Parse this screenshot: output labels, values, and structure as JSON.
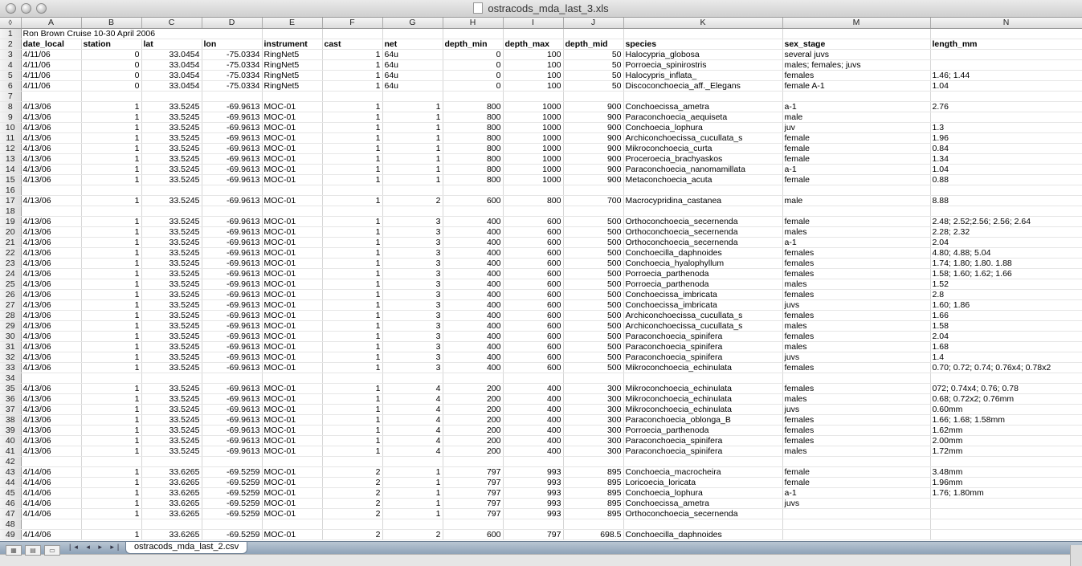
{
  "window": {
    "title": "ostracods_mda_last_3.xls"
  },
  "columns": [
    "A",
    "B",
    "C",
    "D",
    "E",
    "F",
    "G",
    "H",
    "I",
    "J",
    "K",
    "M",
    "N"
  ],
  "sheet_tab": "ostracods_mda_last_2.csv",
  "row1_text": "Ron Brown Cruise 10-30 April 2006",
  "rows": [
    {
      "n": "1",
      "c": [
        "Ron Brown Cruise 10-30 April 2006",
        "",
        "",
        "",
        "",
        "",
        "",
        "",
        "",
        "",
        "",
        "",
        ""
      ]
    },
    {
      "n": "2",
      "c": [
        "date_local",
        "station",
        "lat",
        "lon",
        "instrument",
        "cast",
        "net",
        "depth_min",
        "depth_max",
        "depth_mid",
        "species",
        "sex_stage",
        "length_mm"
      ]
    },
    {
      "n": "3",
      "c": [
        "4/11/06",
        "0",
        "33.0454",
        "-75.0334",
        "RingNet5",
        "1",
        "64u",
        "0",
        "100",
        "50",
        "Halocypria_globosa",
        "several juvs",
        ""
      ]
    },
    {
      "n": "4",
      "c": [
        "4/11/06",
        "0",
        "33.0454",
        "-75.0334",
        "RingNet5",
        "1",
        "64u",
        "0",
        "100",
        "50",
        "Porroecia_spinirostris",
        "males; females; juvs",
        ""
      ]
    },
    {
      "n": "5",
      "c": [
        "4/11/06",
        "0",
        "33.0454",
        "-75.0334",
        "RingNet5",
        "1",
        "64u",
        "0",
        "100",
        "50",
        "Halocypris_inflata_",
        "females",
        "1.46; 1.44"
      ]
    },
    {
      "n": "6",
      "c": [
        "4/11/06",
        "0",
        "33.0454",
        "-75.0334",
        "RingNet5",
        "1",
        "64u",
        "0",
        "100",
        "50",
        "Discoconchoecia_aff._Elegans",
        "female A-1",
        "1.04"
      ]
    },
    {
      "n": "7",
      "c": [
        "",
        "",
        "",
        "",
        "",
        "",
        "",
        "",
        "",
        "",
        "",
        "",
        ""
      ]
    },
    {
      "n": "8",
      "c": [
        "4/13/06",
        "1",
        "33.5245",
        "-69.9613",
        "MOC-01",
        "1",
        "1",
        "800",
        "1000",
        "900",
        "Conchoecissa_ametra",
        "a-1",
        "2.76"
      ]
    },
    {
      "n": "9",
      "c": [
        "4/13/06",
        "1",
        "33.5245",
        "-69.9613",
        "MOC-01",
        "1",
        "1",
        "800",
        "1000",
        "900",
        "Paraconchoecia_aequiseta",
        "male",
        ""
      ]
    },
    {
      "n": "10",
      "c": [
        "4/13/06",
        "1",
        "33.5245",
        "-69.9613",
        "MOC-01",
        "1",
        "1",
        "800",
        "1000",
        "900",
        "Conchoecia_lophura",
        "juv",
        "1.3"
      ]
    },
    {
      "n": "11",
      "c": [
        "4/13/06",
        "1",
        "33.5245",
        "-69.9613",
        "MOC-01",
        "1",
        "1",
        "800",
        "1000",
        "900",
        "Archiconchoecissa_cucullata_s",
        "female",
        "1.96"
      ]
    },
    {
      "n": "12",
      "c": [
        "4/13/06",
        "1",
        "33.5245",
        "-69.9613",
        "MOC-01",
        "1",
        "1",
        "800",
        "1000",
        "900",
        "Mikroconchoecia_curta",
        "female",
        "0.84"
      ]
    },
    {
      "n": "13",
      "c": [
        "4/13/06",
        "1",
        "33.5245",
        "-69.9613",
        "MOC-01",
        "1",
        "1",
        "800",
        "1000",
        "900",
        "Proceroecia_brachyaskos",
        "female",
        "1.34"
      ]
    },
    {
      "n": "14",
      "c": [
        "4/13/06",
        "1",
        "33.5245",
        "-69.9613",
        "MOC-01",
        "1",
        "1",
        "800",
        "1000",
        "900",
        "Paraconchoecia_nanomamillata",
        "a-1",
        "1.04"
      ]
    },
    {
      "n": "15",
      "c": [
        "4/13/06",
        "1",
        "33.5245",
        "-69.9613",
        "MOC-01",
        "1",
        "1",
        "800",
        "1000",
        "900",
        "Metaconchoecia_acuta",
        "female",
        "0.88"
      ]
    },
    {
      "n": "16",
      "c": [
        "",
        "",
        "",
        "",
        "",
        "",
        "",
        "",
        "",
        "",
        "",
        "",
        ""
      ]
    },
    {
      "n": "17",
      "c": [
        "4/13/06",
        "1",
        "33.5245",
        "-69.9613",
        "MOC-01",
        "1",
        "2",
        "600",
        "800",
        "700",
        "Macrocypridina_castanea",
        "male",
        "8.88"
      ]
    },
    {
      "n": "18",
      "c": [
        "",
        "",
        "",
        "",
        "",
        "",
        "",
        "",
        "",
        "",
        "",
        "",
        ""
      ]
    },
    {
      "n": "19",
      "c": [
        "4/13/06",
        "1",
        "33.5245",
        "-69.9613",
        "MOC-01",
        "1",
        "3",
        "400",
        "600",
        "500",
        "Orthoconchoecia_secernenda",
        "female",
        "2.48; 2.52;2.56; 2.56; 2.64"
      ]
    },
    {
      "n": "20",
      "c": [
        "4/13/06",
        "1",
        "33.5245",
        "-69.9613",
        "MOC-01",
        "1",
        "3",
        "400",
        "600",
        "500",
        "Orthoconchoecia_secernenda",
        "males",
        "2.28; 2.32"
      ]
    },
    {
      "n": "21",
      "c": [
        "4/13/06",
        "1",
        "33.5245",
        "-69.9613",
        "MOC-01",
        "1",
        "3",
        "400",
        "600",
        "500",
        "Orthoconchoecia_secernenda",
        "a-1",
        "2.04"
      ]
    },
    {
      "n": "22",
      "c": [
        "4/13/06",
        "1",
        "33.5245",
        "-69.9613",
        "MOC-01",
        "1",
        "3",
        "400",
        "600",
        "500",
        "Conchoecilla_daphnoides",
        "females",
        "4.80; 4.88; 5.04"
      ]
    },
    {
      "n": "23",
      "c": [
        "4/13/06",
        "1",
        "33.5245",
        "-69.9613",
        "MOC-01",
        "1",
        "3",
        "400",
        "600",
        "500",
        "Conchoecia_hyalophyllum",
        "females",
        "1.74; 1.80; 1.80. 1.88"
      ]
    },
    {
      "n": "24",
      "c": [
        "4/13/06",
        "1",
        "33.5245",
        "-69.9613",
        "MOC-01",
        "1",
        "3",
        "400",
        "600",
        "500",
        "Porroecia_parthenoda",
        "females",
        "1.58; 1.60; 1.62; 1.66"
      ]
    },
    {
      "n": "25",
      "c": [
        "4/13/06",
        "1",
        "33.5245",
        "-69.9613",
        "MOC-01",
        "1",
        "3",
        "400",
        "600",
        "500",
        "Porroecia_parthenoda",
        "males",
        "1.52"
      ]
    },
    {
      "n": "26",
      "c": [
        "4/13/06",
        "1",
        "33.5245",
        "-69.9613",
        "MOC-01",
        "1",
        "3",
        "400",
        "600",
        "500",
        "Conchoecissa_imbricata",
        "females",
        "2.8"
      ]
    },
    {
      "n": "27",
      "c": [
        "4/13/06",
        "1",
        "33.5245",
        "-69.9613",
        "MOC-01",
        "1",
        "3",
        "400",
        "600",
        "500",
        "Conchoecissa_imbricata",
        "juvs",
        "1.60; 1.86"
      ]
    },
    {
      "n": "28",
      "c": [
        "4/13/06",
        "1",
        "33.5245",
        "-69.9613",
        "MOC-01",
        "1",
        "3",
        "400",
        "600",
        "500",
        "Archiconchoecissa_cucullata_s",
        "females",
        "1.66"
      ]
    },
    {
      "n": "29",
      "c": [
        "4/13/06",
        "1",
        "33.5245",
        "-69.9613",
        "MOC-01",
        "1",
        "3",
        "400",
        "600",
        "500",
        "Archiconchoecissa_cucullata_s",
        "males",
        "1.58"
      ]
    },
    {
      "n": "30",
      "c": [
        "4/13/06",
        "1",
        "33.5245",
        "-69.9613",
        "MOC-01",
        "1",
        "3",
        "400",
        "600",
        "500",
        "Paraconchoecia_spinifera",
        "females",
        "2.04"
      ]
    },
    {
      "n": "31",
      "c": [
        "4/13/06",
        "1",
        "33.5245",
        "-69.9613",
        "MOC-01",
        "1",
        "3",
        "400",
        "600",
        "500",
        "Paraconchoecia_spinifera",
        "males",
        "1.68"
      ]
    },
    {
      "n": "32",
      "c": [
        "4/13/06",
        "1",
        "33.5245",
        "-69.9613",
        "MOC-01",
        "1",
        "3",
        "400",
        "600",
        "500",
        "Paraconchoecia_spinifera",
        "juvs",
        "1.4"
      ]
    },
    {
      "n": "33",
      "c": [
        "4/13/06",
        "1",
        "33.5245",
        "-69.9613",
        "MOC-01",
        "1",
        "3",
        "400",
        "600",
        "500",
        "Mikroconchoecia_echinulata",
        "females",
        "0.70; 0.72; 0.74; 0.76x4; 0.78x2"
      ]
    },
    {
      "n": "34",
      "c": [
        "",
        "",
        "",
        "",
        "",
        "",
        "",
        "",
        "",
        "",
        "",
        "",
        ""
      ]
    },
    {
      "n": "35",
      "c": [
        "4/13/06",
        "1",
        "33.5245",
        "-69.9613",
        "MOC-01",
        "1",
        "4",
        "200",
        "400",
        "300",
        "Mikroconchoecia_echinulata",
        "females",
        "072; 0.74x4; 0.76; 0.78"
      ]
    },
    {
      "n": "36",
      "c": [
        "4/13/06",
        "1",
        "33.5245",
        "-69.9613",
        "MOC-01",
        "1",
        "4",
        "200",
        "400",
        "300",
        "Mikroconchoecia_echinulata",
        "males",
        "0.68; 0.72x2; 0.76mm"
      ]
    },
    {
      "n": "37",
      "c": [
        "4/13/06",
        "1",
        "33.5245",
        "-69.9613",
        "MOC-01",
        "1",
        "4",
        "200",
        "400",
        "300",
        "Mikroconchoecia_echinulata",
        "juvs",
        "0.60mm"
      ]
    },
    {
      "n": "38",
      "c": [
        "4/13/06",
        "1",
        "33.5245",
        "-69.9613",
        "MOC-01",
        "1",
        "4",
        "200",
        "400",
        "300",
        "Paraconchoecia_oblonga_B",
        "females",
        "1.66; 1.68; 1.58mm"
      ]
    },
    {
      "n": "39",
      "c": [
        "4/13/06",
        "1",
        "33.5245",
        "-69.9613",
        "MOC-01",
        "1",
        "4",
        "200",
        "400",
        "300",
        "Porroecia_parthenoda",
        "females",
        "1.62mm"
      ]
    },
    {
      "n": "40",
      "c": [
        "4/13/06",
        "1",
        "33.5245",
        "-69.9613",
        "MOC-01",
        "1",
        "4",
        "200",
        "400",
        "300",
        "Paraconchoecia_spinifera",
        "females",
        "2.00mm"
      ]
    },
    {
      "n": "41",
      "c": [
        "4/13/06",
        "1",
        "33.5245",
        "-69.9613",
        "MOC-01",
        "1",
        "4",
        "200",
        "400",
        "300",
        "Paraconchoecia_spinifera",
        "males",
        "1.72mm"
      ]
    },
    {
      "n": "42",
      "c": [
        "",
        "",
        "",
        "",
        "",
        "",
        "",
        "",
        "",
        "",
        "",
        "",
        ""
      ]
    },
    {
      "n": "43",
      "c": [
        "4/14/06",
        "1",
        "33.6265",
        "-69.5259",
        "MOC-01",
        "2",
        "1",
        "797",
        "993",
        "895",
        "Conchoecia_macrocheira",
        "female",
        "3.48mm"
      ]
    },
    {
      "n": "44",
      "c": [
        "4/14/06",
        "1",
        "33.6265",
        "-69.5259",
        "MOC-01",
        "2",
        "1",
        "797",
        "993",
        "895",
        "Loricoecia_loricata",
        "female",
        "1.96mm"
      ]
    },
    {
      "n": "45",
      "c": [
        "4/14/06",
        "1",
        "33.6265",
        "-69.5259",
        "MOC-01",
        "2",
        "1",
        "797",
        "993",
        "895",
        "Conchoecia_lophura",
        "a-1",
        "1.76; 1.80mm"
      ]
    },
    {
      "n": "46",
      "c": [
        "4/14/06",
        "1",
        "33.6265",
        "-69.5259",
        "MOC-01",
        "2",
        "1",
        "797",
        "993",
        "895",
        "Conchoecissa_ametra",
        "juvs",
        ""
      ]
    },
    {
      "n": "47",
      "c": [
        "4/14/06",
        "1",
        "33.6265",
        "-69.5259",
        "MOC-01",
        "2",
        "1",
        "797",
        "993",
        "895",
        "Orthoconchoecia_secernenda",
        "",
        ""
      ]
    },
    {
      "n": "48",
      "c": [
        "",
        "",
        "",
        "",
        "",
        "",
        "",
        "",
        "",
        "",
        "",
        "",
        ""
      ]
    },
    {
      "n": "49",
      "c": [
        "4/14/06",
        "1",
        "33.6265",
        "-69.5259",
        "MOC-01",
        "2",
        "2",
        "600",
        "797",
        "698.5",
        "Conchoecilla_daphnoides",
        "",
        ""
      ]
    }
  ]
}
